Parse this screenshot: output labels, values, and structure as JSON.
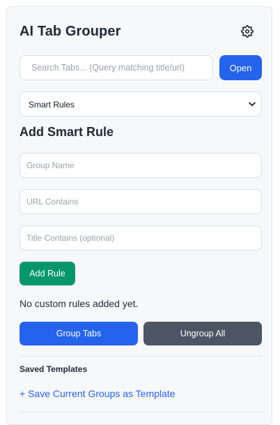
{
  "header": {
    "title": "AI Tab Grouper",
    "settings_icon": "gear-icon"
  },
  "search": {
    "placeholder": "Search Tabs... (Query matching title/url)",
    "value": "",
    "open_label": "Open"
  },
  "mode_select": {
    "selected": "Smart Rules",
    "icon": "chevron-down-icon"
  },
  "smart_rule": {
    "heading": "Add Smart Rule",
    "group_name_placeholder": "Group Name",
    "url_contains_placeholder": "URL Contains",
    "title_contains_placeholder": "Title Contains (optional)",
    "add_button_label": "Add Rule",
    "empty_message": "No custom rules added yet."
  },
  "actions": {
    "group_label": "Group Tabs",
    "ungroup_label": "Ungroup All"
  },
  "templates": {
    "heading": "Saved Templates",
    "save_link": "+ Save Current Groups as Template"
  },
  "colors": {
    "primary": "#2563eb",
    "success": "#059669",
    "secondary": "#4b5563",
    "text": "#1f2937"
  }
}
